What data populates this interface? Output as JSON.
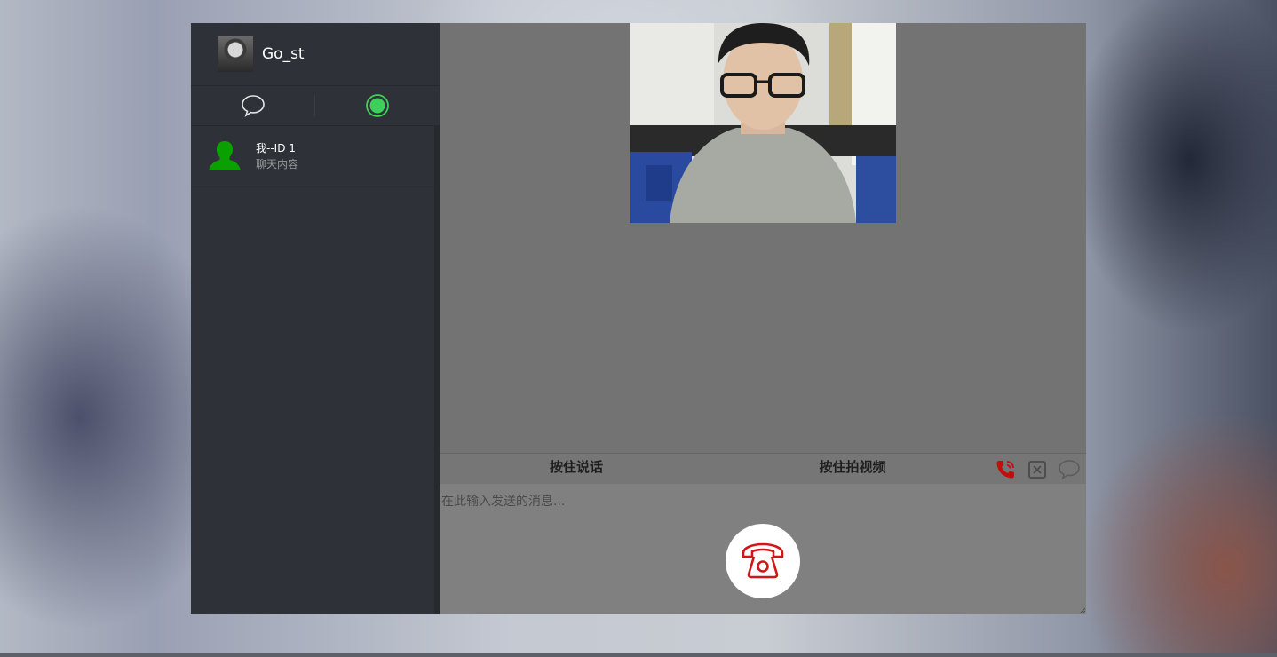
{
  "profile": {
    "name": "Go_st",
    "avatar_icon": "user-photo-avatar"
  },
  "sidebar": {
    "tabs": [
      {
        "icon": "chat-bubble-icon",
        "active": false
      },
      {
        "icon": "online-status-icon",
        "active": true,
        "accent": "#3ecf5a"
      }
    ],
    "contacts": [
      {
        "name": "我--ID 1",
        "preview": "聊天内容",
        "avatar_icon": "user-silhouette-icon",
        "avatar_color": "#0aa000"
      }
    ]
  },
  "call": {
    "video_icon": "remote-video-stream"
  },
  "toolbar": {
    "hold_to_talk": "按住说话",
    "hold_to_record_video": "按住拍视频",
    "icons": [
      "phone-call-icon",
      "close-box-icon",
      "chat-bubble-icon"
    ],
    "call_icon_color": "#c40d0d"
  },
  "composer": {
    "placeholder": "在此输入发送的消息...",
    "hangup_icon": "telephone-icon",
    "hangup_color": "#d01616"
  },
  "colors": {
    "sidebar_bg": "#2e3238",
    "main_bg": "#737373"
  }
}
